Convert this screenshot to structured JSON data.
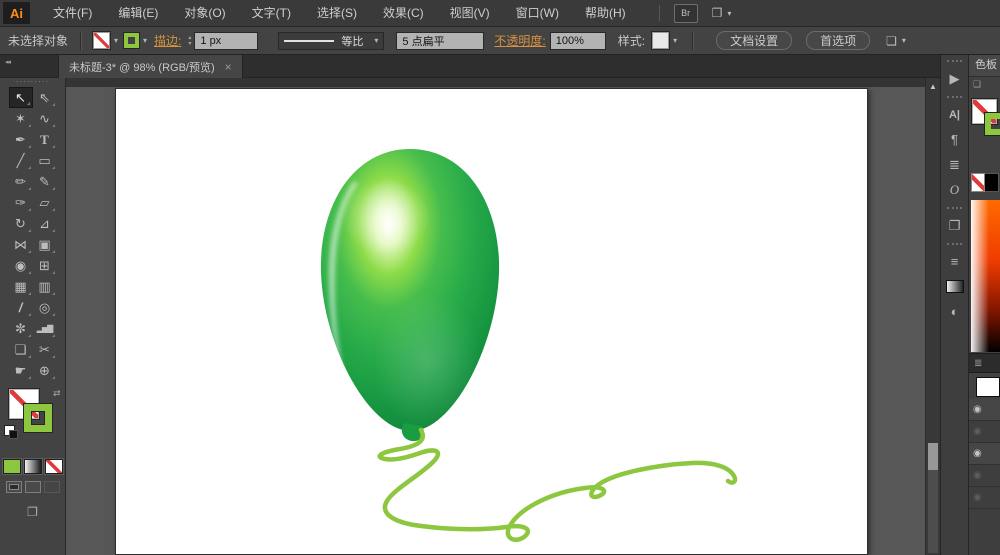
{
  "app": {
    "logo_text": "Ai"
  },
  "ui": {
    "dd": "▾",
    "up": "▴",
    "dots": "·········",
    "collapse": "◂◂",
    "swap_glyph": "⇄",
    "screen_glyph": "❐",
    "panel_menu_glyph": "❏",
    "scroll_up_glyph": "▲",
    "layers_tab_glyph": "≣",
    "mini_panel_glyph": "❏"
  },
  "menu_bar": {
    "items": [
      {
        "name": "file",
        "label": "文件(F)"
      },
      {
        "name": "edit",
        "label": "编辑(E)"
      },
      {
        "name": "object",
        "label": "对象(O)"
      },
      {
        "name": "type",
        "label": "文字(T)"
      },
      {
        "name": "select",
        "label": "选择(S)"
      },
      {
        "name": "effect",
        "label": "效果(C)"
      },
      {
        "name": "view",
        "label": "视图(V)"
      },
      {
        "name": "window",
        "label": "窗口(W)"
      },
      {
        "name": "help",
        "label": "帮助(H)"
      }
    ],
    "bridge_label": "Br"
  },
  "control_bar": {
    "status_text": "未选择对象",
    "stroke_label": "描边:",
    "stroke_width_value": "1 px",
    "profile_value": "等比",
    "brush_value": "5 点扁平",
    "opacity_label": "不透明度:",
    "opacity_value": "100%",
    "style_label": "样式:",
    "document_setup_label": "文档设置",
    "preferences_label": "首选项"
  },
  "tab_bar": {
    "document_title": "未标题-3* @ 98% (RGB/预览)",
    "close_glyph": "×"
  },
  "toolbar": {
    "tools": [
      {
        "name": "selection",
        "glyph": "↖",
        "selected": true
      },
      {
        "name": "direct-selection",
        "glyph": "⇖"
      },
      {
        "name": "magic-wand",
        "glyph": "✶"
      },
      {
        "name": "lasso",
        "glyph": "∿"
      },
      {
        "name": "pen",
        "glyph": "✒"
      },
      {
        "name": "type",
        "glyph": "T"
      },
      {
        "name": "line-segment",
        "glyph": "╱"
      },
      {
        "name": "rectangle",
        "glyph": "▭"
      },
      {
        "name": "paintbrush",
        "glyph": "✏"
      },
      {
        "name": "pencil",
        "glyph": "✎"
      },
      {
        "name": "blob-brush",
        "glyph": "✑"
      },
      {
        "name": "eraser",
        "glyph": "▱"
      },
      {
        "name": "rotate",
        "glyph": "↻"
      },
      {
        "name": "scale",
        "glyph": "⊿"
      },
      {
        "name": "width",
        "glyph": "⋈"
      },
      {
        "name": "free-transform",
        "glyph": "▣"
      },
      {
        "name": "shape-builder",
        "glyph": "◉"
      },
      {
        "name": "perspective-grid",
        "glyph": "⊞"
      },
      {
        "name": "mesh",
        "glyph": "▦"
      },
      {
        "name": "gradient",
        "glyph": "▥"
      },
      {
        "name": "eyedropper",
        "glyph": "/"
      },
      {
        "name": "blend",
        "glyph": "◎"
      },
      {
        "name": "symbol-sprayer",
        "glyph": "✼"
      },
      {
        "name": "column-graph",
        "glyph": "▂▅▇"
      },
      {
        "name": "artboard",
        "glyph": "❏"
      },
      {
        "name": "slice",
        "glyph": "✂"
      },
      {
        "name": "hand",
        "glyph": "☛"
      },
      {
        "name": "zoom",
        "glyph": "⊕"
      }
    ]
  },
  "artwork": {
    "balloon_main_color": "#2fb14d",
    "balloon_dark_color": "#0e8438",
    "balloon_highlight_color": "#ffffff",
    "string_color": "#8dc63f"
  },
  "right_dock": {
    "icons": [
      {
        "name": "actions-panel",
        "glyph": "▶",
        "gap": true
      },
      {
        "name": "character-panel",
        "glyph": "A|",
        "gap": true
      },
      {
        "name": "paragraph-panel",
        "glyph": "¶"
      },
      {
        "name": "opentype-panel",
        "glyph": "≣"
      },
      {
        "name": "appearance-panel",
        "glyph": "O"
      },
      {
        "name": "graphic-styles-panel",
        "glyph": "❐",
        "gap": true
      },
      {
        "name": "stroke-panel",
        "glyph": "≡",
        "gap": true
      },
      {
        "name": "gradient-panel",
        "glyph": ""
      },
      {
        "name": "transparency-panel",
        "glyph": "◐"
      }
    ]
  },
  "color_panel": {
    "title": "色板"
  },
  "layers_panel": {
    "eye_glyph": "◉",
    "rows": [
      {
        "name": "row-1",
        "visible": true
      },
      {
        "name": "row-2",
        "visible": false
      },
      {
        "name": "row-3",
        "visible": true
      },
      {
        "name": "row-4",
        "visible": false
      },
      {
        "name": "row-5",
        "visible": false
      }
    ]
  }
}
